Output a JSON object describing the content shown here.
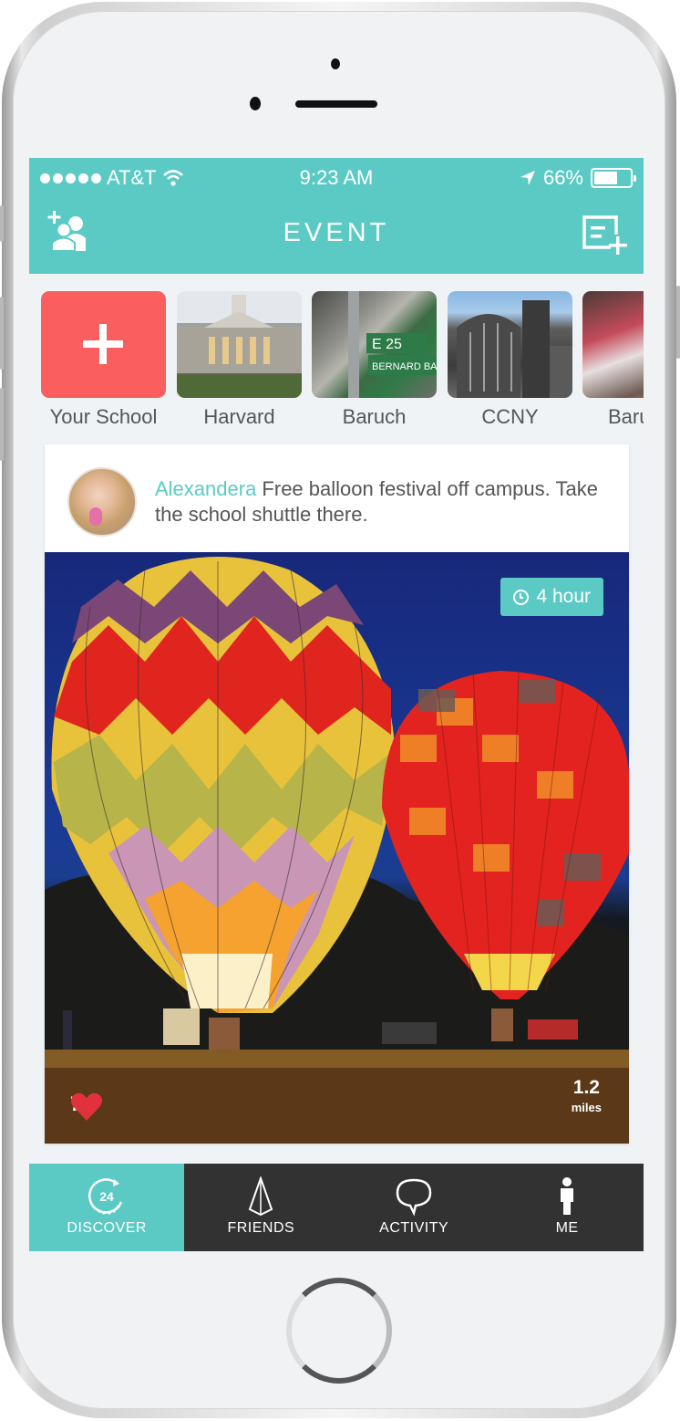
{
  "status_bar": {
    "carrier": "AT&T",
    "time": "9:23 AM",
    "battery_percent_label": "66%",
    "battery_level": 0.66
  },
  "header": {
    "title": "EVENT",
    "left_icon": "add-friend-icon",
    "right_icon": "new-post-icon"
  },
  "schools": [
    {
      "label": "Your School",
      "icon": "plus-icon"
    },
    {
      "label": "Harvard"
    },
    {
      "label": "Baruch"
    },
    {
      "label": "CCNY"
    },
    {
      "label": "Baru"
    }
  ],
  "post": {
    "author": "Alexandera",
    "text": " Free balloon festival off campus. Take the school shuttle there.",
    "time_badge": "4 hour",
    "likes": "7",
    "distance_value": "1.2",
    "distance_unit": "miles"
  },
  "tabs": [
    {
      "label": "DISCOVER",
      "icon": "discover-24-icon",
      "active": true
    },
    {
      "label": "FRIENDS",
      "icon": "friends-pyramid-icon",
      "active": false
    },
    {
      "label": "ACTIVITY",
      "icon": "speech-bubble-icon",
      "active": false
    },
    {
      "label": "ME",
      "icon": "person-icon",
      "active": false
    }
  ],
  "colors": {
    "accent": "#5bcac5",
    "add_tile": "#fa5e5f",
    "tabbar": "#323232",
    "heart": "#e0313c"
  }
}
